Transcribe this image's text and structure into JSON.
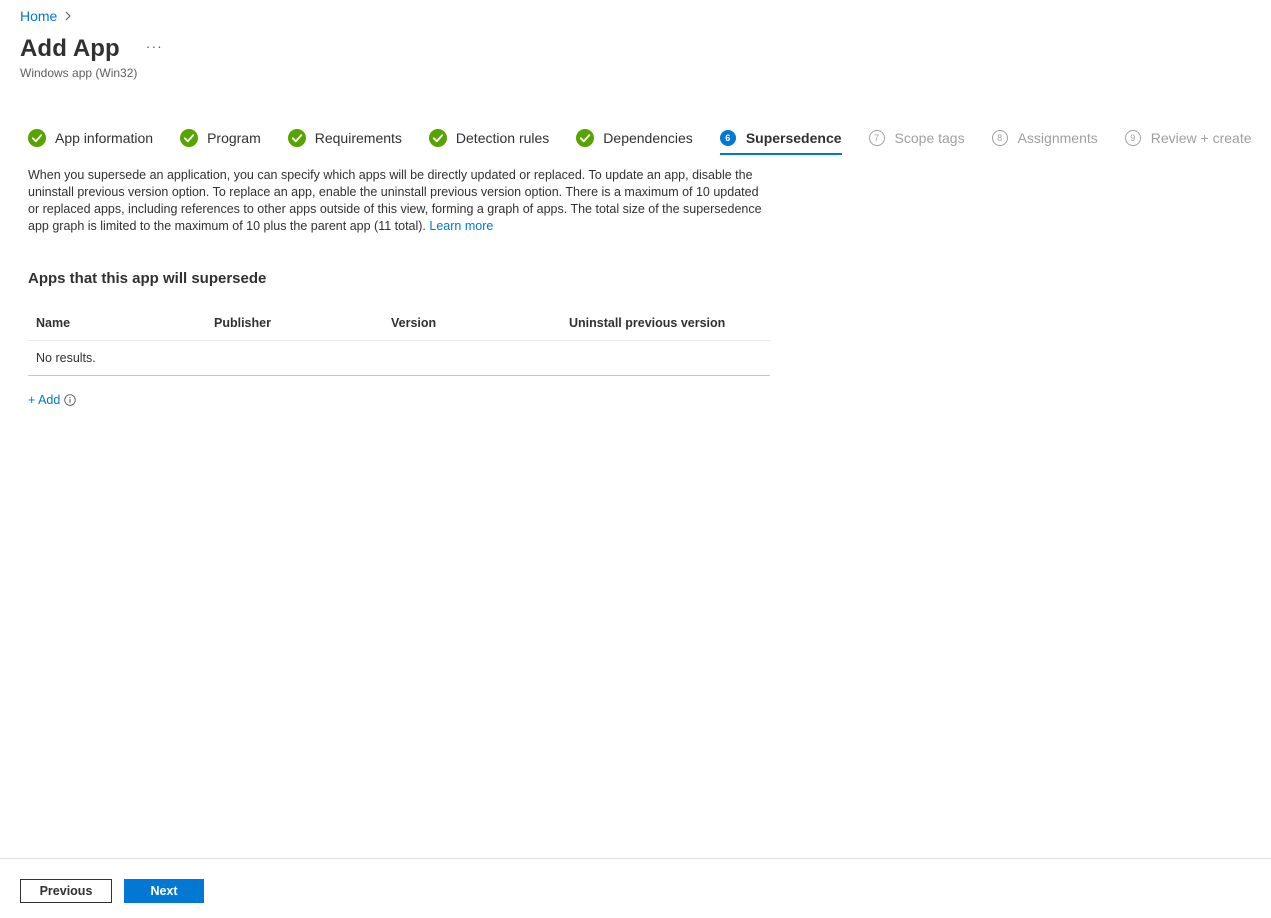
{
  "breadcrumb": {
    "home": "Home"
  },
  "header": {
    "title": "Add App",
    "more": "···",
    "subtitle": "Windows app (Win32)"
  },
  "steps": [
    {
      "label": "App information",
      "state": "done"
    },
    {
      "label": "Program",
      "state": "done"
    },
    {
      "label": "Requirements",
      "state": "done"
    },
    {
      "label": "Detection rules",
      "state": "done"
    },
    {
      "label": "Dependencies",
      "state": "done"
    },
    {
      "label": "Supersedence",
      "state": "current",
      "number": "6"
    },
    {
      "label": "Scope tags",
      "state": "future",
      "number": "7"
    },
    {
      "label": "Assignments",
      "state": "future",
      "number": "8"
    },
    {
      "label": "Review + create",
      "state": "future",
      "number": "9"
    }
  ],
  "description": {
    "text": "When you supersede an application, you can specify which apps will be directly updated or replaced. To update an app, disable the uninstall previous version option. To replace an app, enable the uninstall previous version option. There is a maximum of 10 updated or replaced apps, including references to other apps outside of this view, forming a graph of apps. The total size of the supersedence app graph is limited to the maximum of 10 plus the parent app (11 total).",
    "learn_more": "Learn more"
  },
  "section": {
    "title": "Apps that this app will supersede"
  },
  "table": {
    "columns": [
      "Name",
      "Publisher",
      "Version",
      "Uninstall previous version"
    ],
    "empty_text": "No results."
  },
  "add": {
    "label": "+ Add"
  },
  "footer": {
    "previous": "Previous",
    "next": "Next"
  },
  "colors": {
    "accent": "#0078d4",
    "done": "#57a300",
    "muted": "#a19f9d"
  }
}
